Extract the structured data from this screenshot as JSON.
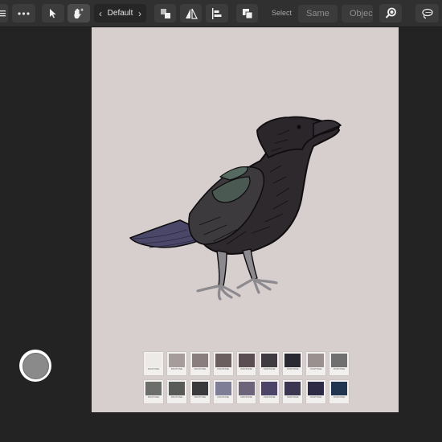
{
  "toolbar": {
    "menu_icon": "hamburger-menu-icon",
    "more_icon": "ellipsis-icon",
    "move_tool_icon": "pointer-arrow-icon",
    "hand_tool_icon": "hand-sparkle-icon",
    "context_prev": "‹",
    "context_label": "Default",
    "context_next": "›",
    "arrange_icon": "arrange-icon",
    "flip_icon": "flip-icon",
    "align_icon": "align-icon",
    "boolean_icon": "boolean-ops-icon",
    "select_label": "Select",
    "same_label": "Same",
    "object_label": "Objec",
    "zoom_icon": "zoom-icon",
    "lasso_icon": "lasso-icon"
  },
  "swatches": {
    "brand": "PANTONE",
    "rows": [
      [
        {
          "color": "#eeeae8"
        },
        {
          "color": "#a79c9c"
        },
        {
          "color": "#8a7e7e"
        },
        {
          "color": "#6c5f5f"
        },
        {
          "color": "#5a4e52"
        },
        {
          "color": "#3f3b40"
        },
        {
          "color": "#2a2a33"
        },
        {
          "color": "#9a9090"
        },
        {
          "color": "#707070"
        }
      ],
      [
        {
          "color": "#6b6e6a"
        },
        {
          "color": "#585b58"
        },
        {
          "color": "#3a3a3d"
        },
        {
          "color": "#7e7f96"
        },
        {
          "color": "#6c6478"
        },
        {
          "color": "#4e4468"
        },
        {
          "color": "#3c3650"
        },
        {
          "color": "#2c2a44"
        },
        {
          "color": "#213450"
        }
      ]
    ]
  },
  "record_button": {
    "icon": "record-button-icon"
  },
  "colors": {
    "app_bg": "#232323",
    "toolbar_bg": "#303030",
    "page_bg": "#d7cece",
    "raven_body": "#2d282b",
    "raven_wing_green": "#4a5a52",
    "raven_tail_purple": "#4b4768",
    "raven_legs": "#8c8a8e"
  }
}
